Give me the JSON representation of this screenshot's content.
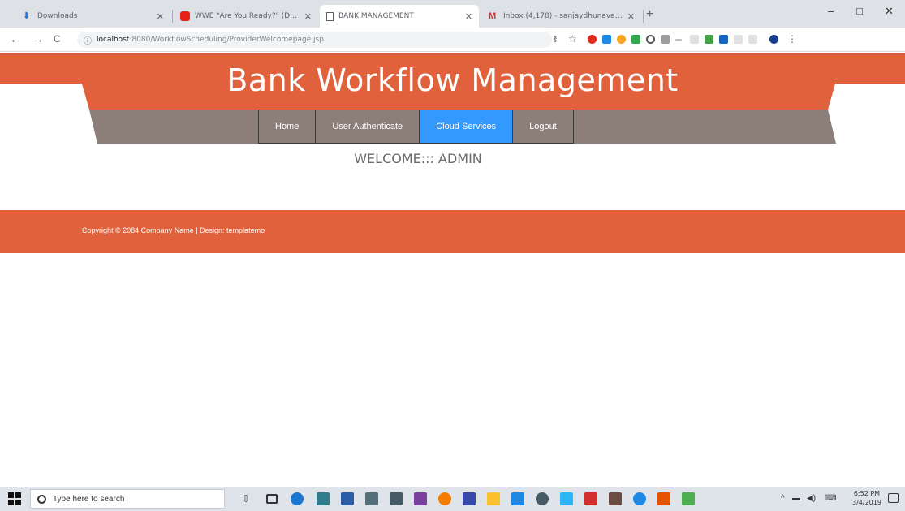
{
  "browser": {
    "tabs": [
      {
        "label": "Downloads",
        "active": false
      },
      {
        "label": "WWE \"Are You Ready?\" (D-Gen...",
        "active": false
      },
      {
        "label": "BANK MANAGEMENT",
        "active": true
      },
      {
        "label": "Inbox (4,178) - sanjaydhunavani...",
        "active": false
      }
    ],
    "new_tab": "+",
    "window_controls": {
      "minimize": "–",
      "maximize": "□",
      "close": "✕"
    },
    "nav": {
      "back": "←",
      "forward": "→",
      "reload": "C"
    },
    "url": {
      "host": "localhost",
      "path": ":8080/WorkflowScheduling/ProviderWelcomepage.jsp"
    }
  },
  "site": {
    "title": "Bank Workflow Management",
    "menu": [
      {
        "label": "Home",
        "active": false
      },
      {
        "label": "User Authenticate",
        "active": false
      },
      {
        "label": "Cloud Services",
        "active": true
      },
      {
        "label": "Logout",
        "active": false
      }
    ],
    "welcome": "WELCOME::: ADMIN",
    "footer": "Copyright © 2084 Company Name | Design: templatemo"
  },
  "colors": {
    "accent": "#e0613c",
    "menu_bg": "#8c7f7a",
    "menu_active": "#3399ff"
  },
  "taskbar": {
    "search_placeholder": "Type here to search",
    "time": "6:52 PM",
    "date": "3/4/2019"
  }
}
